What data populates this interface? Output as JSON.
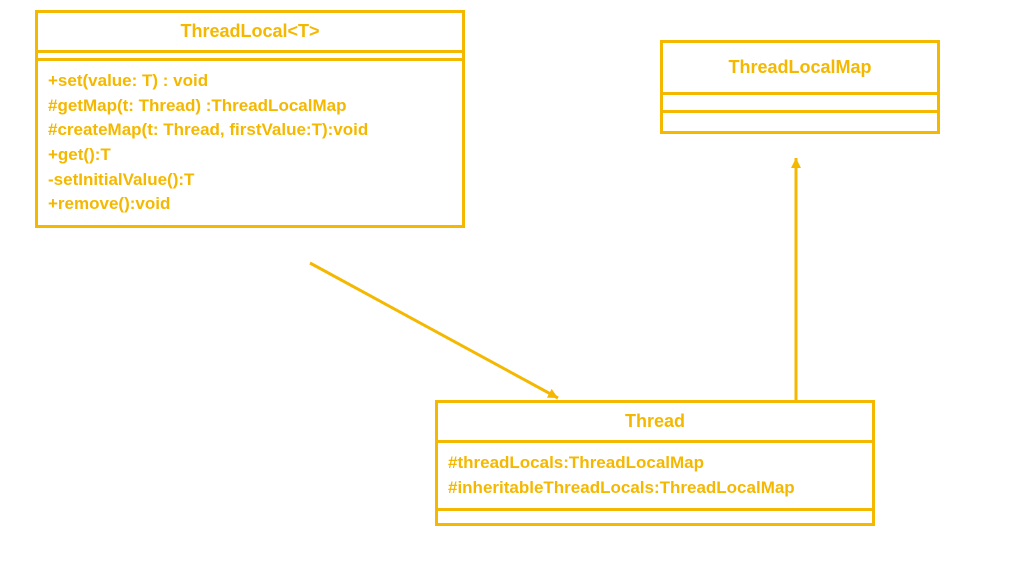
{
  "classes": {
    "threadLocal": {
      "title": "ThreadLocal<T>",
      "methods": [
        "+set(value: T) : void",
        "#getMap(t: Thread) :ThreadLocalMap",
        "#createMap(t: Thread, firstValue:T):void",
        "+get():T",
        "-setInitialValue():T",
        "+remove():void"
      ]
    },
    "threadLocalMap": {
      "title": "ThreadLocalMap"
    },
    "thread": {
      "title": "Thread",
      "attributes": [
        "#threadLocals:ThreadLocalMap",
        "#inheritableThreadLocals:ThreadLocalMap"
      ]
    }
  }
}
